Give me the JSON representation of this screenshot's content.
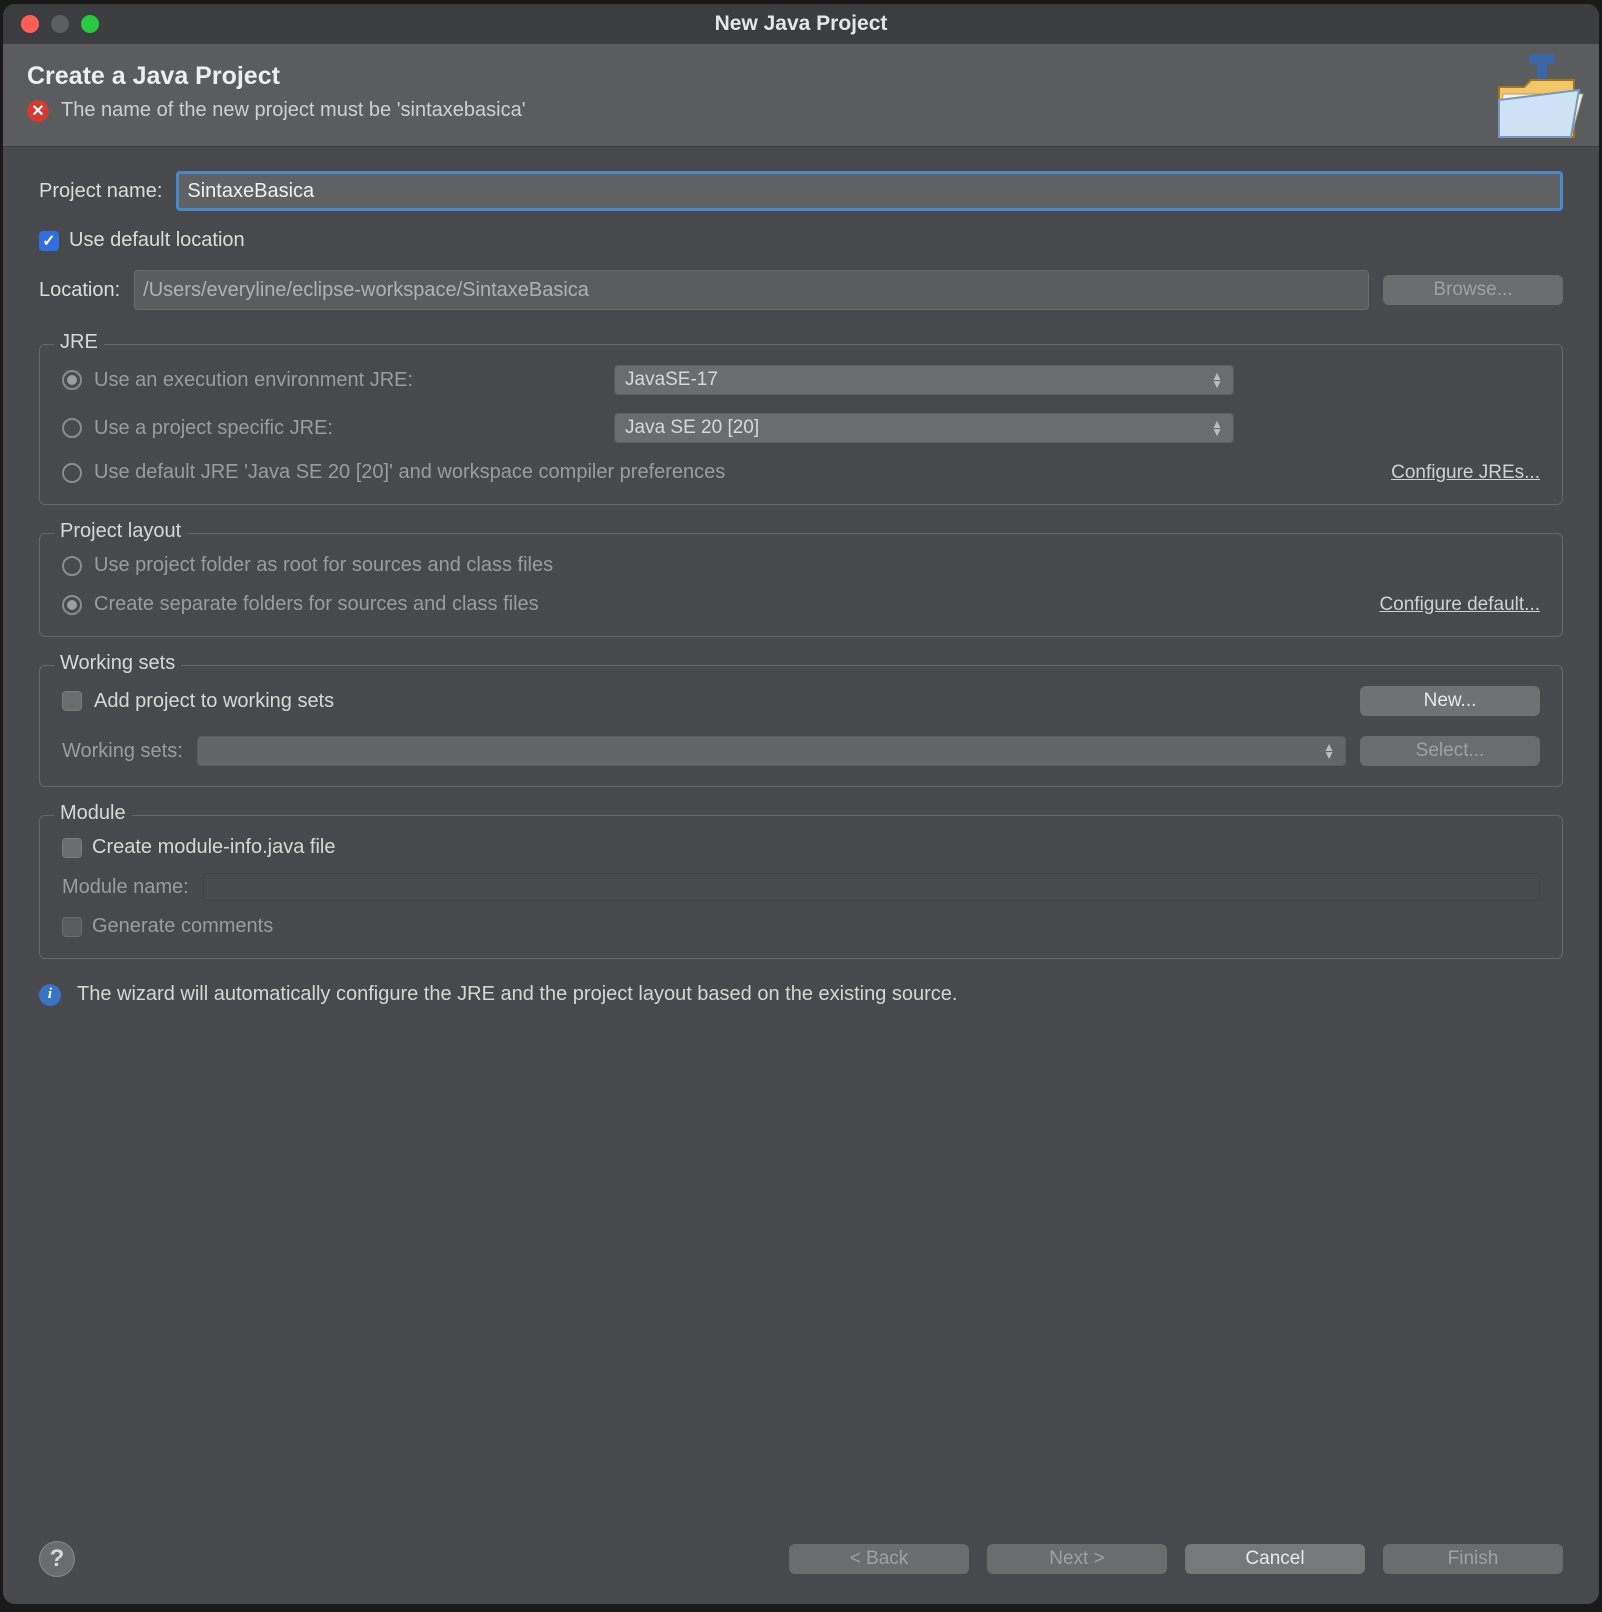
{
  "window": {
    "title": "New Java Project"
  },
  "header": {
    "title": "Create a Java Project",
    "error_message": "The name of the new project must be 'sintaxebasica'"
  },
  "project_name": {
    "label": "Project name:",
    "value": "SintaxeBasica"
  },
  "use_default_location": {
    "label": "Use default location",
    "checked": true
  },
  "location": {
    "label": "Location:",
    "value": "/Users/everyline/eclipse-workspace/SintaxeBasica",
    "browse_label": "Browse..."
  },
  "jre": {
    "group_title": "JRE",
    "exec_env_label": "Use an execution environment JRE:",
    "exec_env_value": "JavaSE-17",
    "project_specific_label": "Use a project specific JRE:",
    "project_specific_value": "Java SE 20 [20]",
    "default_jre_label": "Use default JRE 'Java SE 20 [20]' and workspace compiler preferences",
    "configure_link": "Configure JREs..."
  },
  "project_layout": {
    "group_title": "Project layout",
    "option_root": "Use project folder as root for sources and class files",
    "option_separate": "Create separate folders for sources and class files",
    "configure_link": "Configure default..."
  },
  "working_sets": {
    "group_title": "Working sets",
    "add_label": "Add project to working sets",
    "new_button": "New...",
    "label": "Working sets:",
    "select_button": "Select..."
  },
  "module": {
    "group_title": "Module",
    "create_label": "Create module-info.java file",
    "name_label": "Module name:",
    "generate_label": "Generate comments"
  },
  "info_message": "The wizard will automatically configure the JRE and the project layout based on the existing source.",
  "buttons": {
    "back": "< Back",
    "next": "Next >",
    "cancel": "Cancel",
    "finish": "Finish"
  }
}
